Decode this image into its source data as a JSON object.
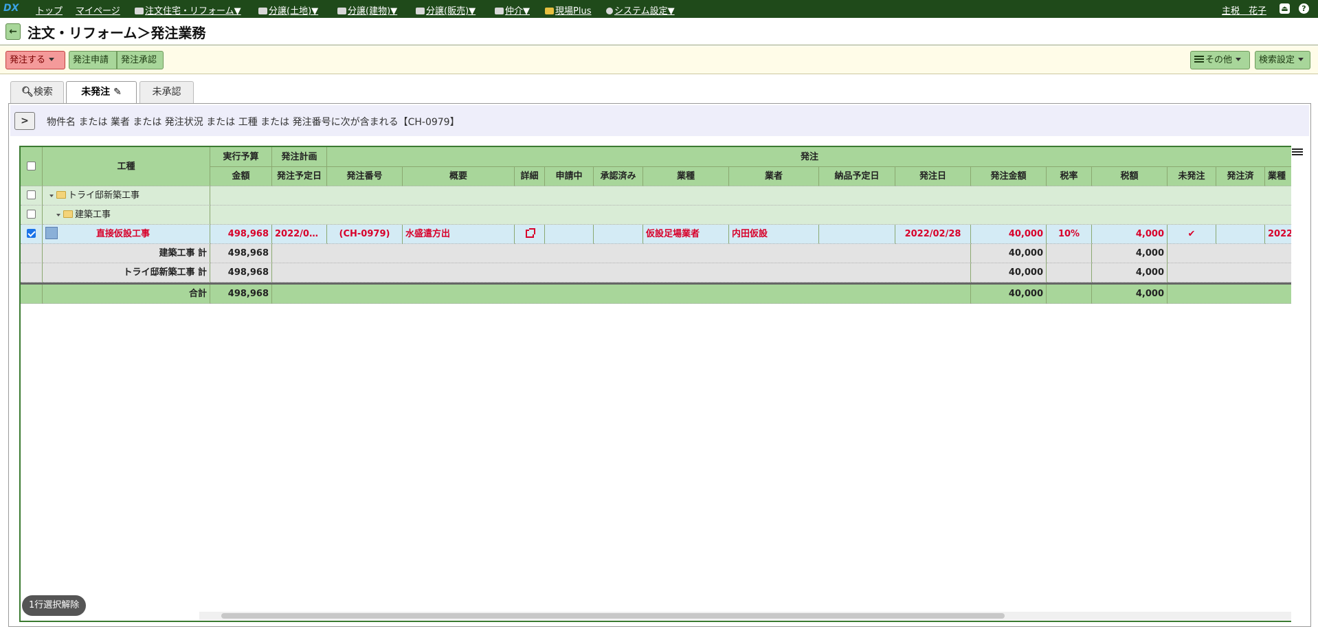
{
  "navbar": {
    "logo": "DX",
    "items": [
      "トップ",
      "マイページ",
      "注文住宅・リフォーム▼",
      "分譲(土地)▼",
      "分譲(建物)▼",
      "分譲(販売)▼",
      "仲介▼",
      "現場Plus",
      "システム設定▼"
    ],
    "user": "主税　花子"
  },
  "title": {
    "back_label": "←",
    "text": "注文・リフォーム＞発注業務"
  },
  "toolbar": {
    "order_label": "発注する",
    "request_label": "発注申請",
    "approve_label": "発注承認",
    "other_label": "その他",
    "search_settings_label": "検索設定"
  },
  "tabs": {
    "search": "検索",
    "unordered": "未発注",
    "unapproved": "未承認"
  },
  "filter": {
    "text": "物件名 または 業者 または 発注状況 または 工種 または 発注番号に次が含まれる【CH-0979】"
  },
  "grid": {
    "headers": {
      "koshu": "工種",
      "budget_group": "実行予算",
      "budget_amount": "金額",
      "plan_group": "発注計画",
      "plan_date": "発注予定日",
      "order_group": "発注",
      "order_no": "発注番号",
      "summary": "概要",
      "detail": "詳細",
      "applying": "申請中",
      "approved": "承認済み",
      "industry": "業種",
      "vendor": "業者",
      "delivery": "納品予定日",
      "order_date": "発注日",
      "order_amount": "発注金額",
      "tax_rate": "税率",
      "tax": "税額",
      "unordered": "未発注",
      "ordered": "発注済",
      "last": "業種"
    },
    "rows": {
      "project": "トライ邸新築工事",
      "category": "建築工事",
      "item": {
        "name": "直接仮設工事",
        "budget": "498,968",
        "plan_date": "2022/0…",
        "order_no": "(CH-0979)",
        "summary": "水盛遣方出",
        "industry": "仮設足場業者",
        "vendor": "内田仮設",
        "order_date": "2022/02/28",
        "amount": "40,000",
        "tax_rate": "10%",
        "tax": "4,000",
        "unordered_mark": "✔",
        "last": "2022"
      },
      "sub1": {
        "label": "建築工事 計",
        "budget": "498,968",
        "amount": "40,000",
        "tax": "4,000"
      },
      "sub2": {
        "label": "トライ邸新築工事 計",
        "budget": "498,968",
        "amount": "40,000",
        "tax": "4,000"
      },
      "total": {
        "label": "合計",
        "budget": "498,968",
        "amount": "40,000",
        "tax": "4,000"
      }
    }
  },
  "release_label": "1行選択解除"
}
